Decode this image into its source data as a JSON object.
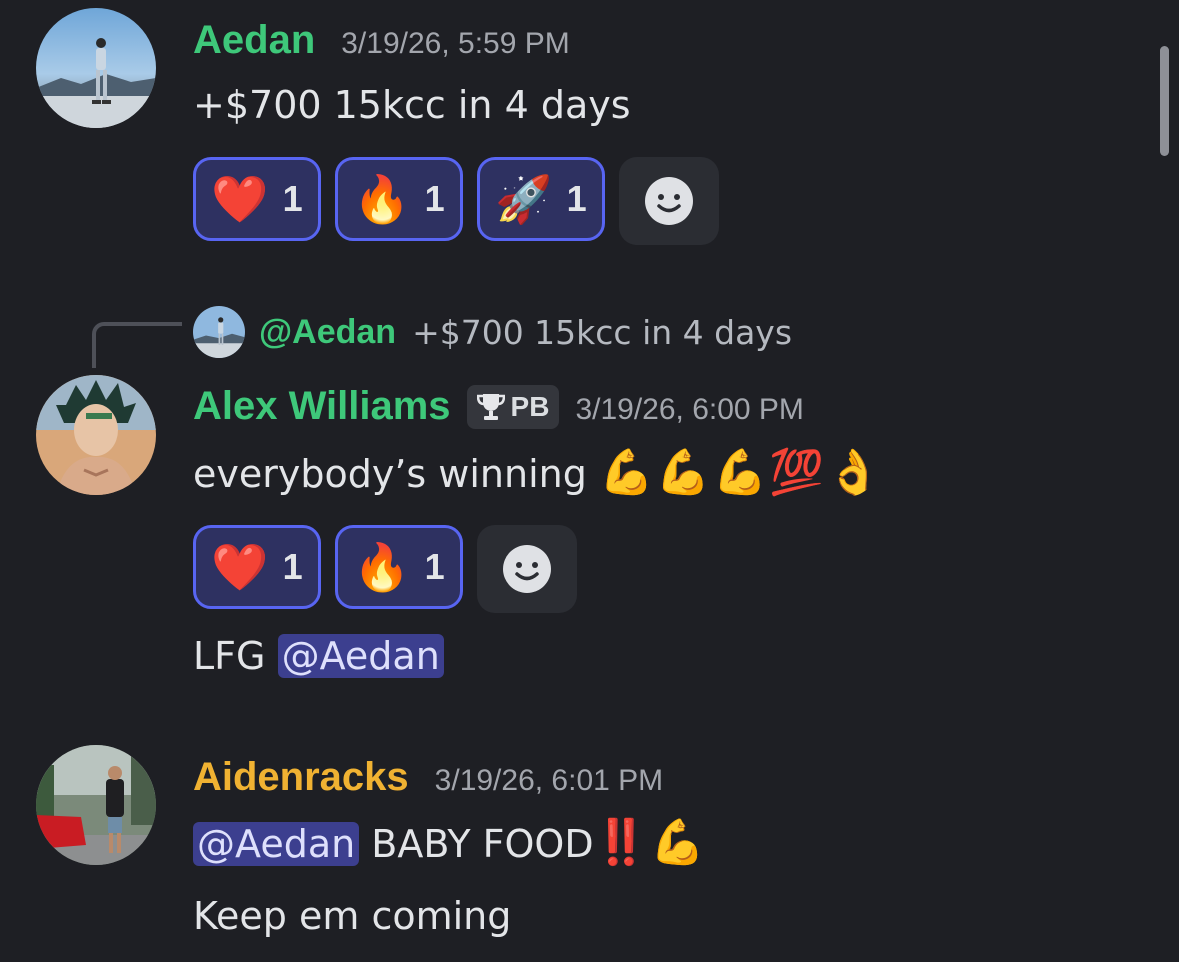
{
  "messages": [
    {
      "username": "Aedan",
      "username_color": "#3ec87a",
      "timestamp": "3/19/26, 5:59 PM",
      "text": "+$700 15kcc in 4 days",
      "reactions": [
        {
          "emoji": "❤️",
          "count": "1"
        },
        {
          "emoji": "🔥",
          "count": "1"
        },
        {
          "emoji": "🚀",
          "count": "1"
        }
      ]
    },
    {
      "reply": {
        "mention": "@Aedan",
        "text": "+$700 15kcc in 4 days"
      },
      "username": "Alex Williams",
      "username_color": "#3ec87a",
      "badge": {
        "icon": "trophy-icon",
        "label": "PB"
      },
      "timestamp": "3/19/26, 6:00 PM",
      "text": "everybody’s winning",
      "text_emojis": "💪💪💪💯👌",
      "reactions": [
        {
          "emoji": "❤️",
          "count": "1"
        },
        {
          "emoji": "🔥",
          "count": "1"
        }
      ],
      "followup": {
        "prefix": "LFG",
        "mention": "@Aedan"
      }
    },
    {
      "username": "Aidenracks",
      "username_color": "#f0b232",
      "timestamp": "3/19/26, 6:01 PM",
      "mention": "@Aedan",
      "text": "BABY FOOD",
      "text_emojis": "‼️💪",
      "followup": "Keep em coming"
    }
  ],
  "icons": {
    "add_reaction": "smiley-add-reaction-icon",
    "mention_highlight": "#3c3f8f",
    "reaction_border": "#5865f2"
  }
}
